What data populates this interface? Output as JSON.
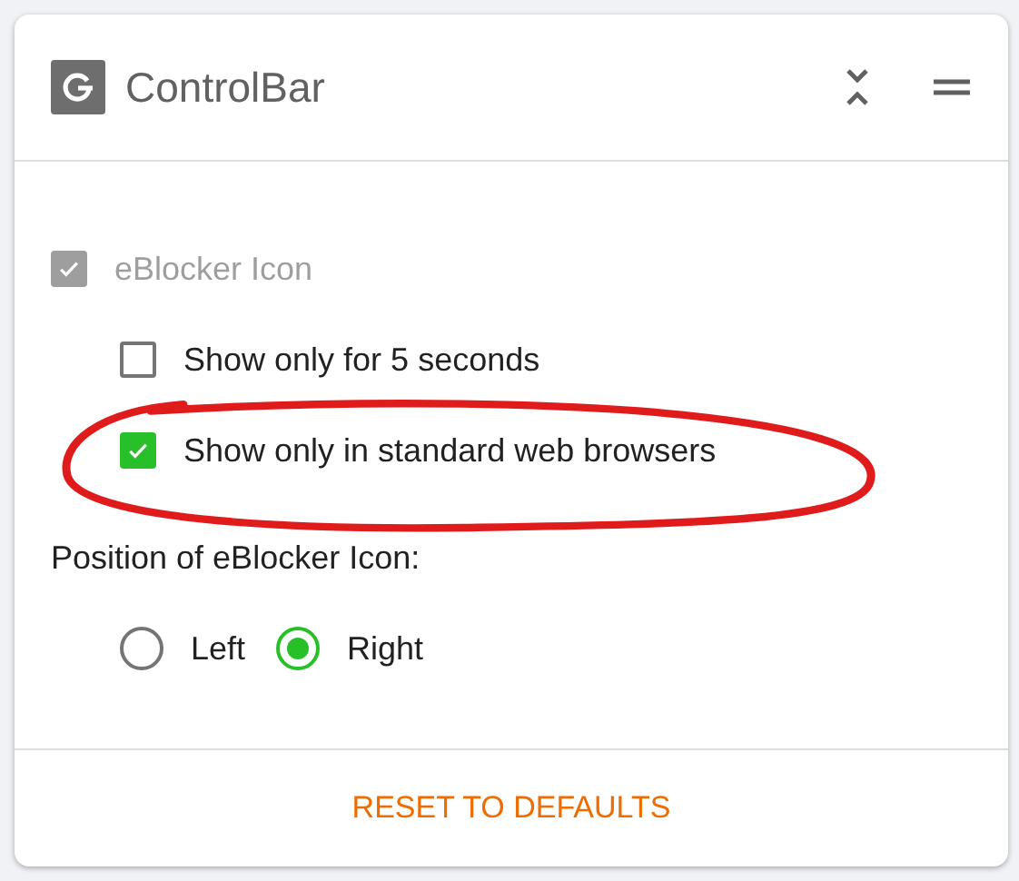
{
  "card": {
    "title": "ControlBar"
  },
  "main_option": {
    "label": "eBlocker Icon",
    "checked": true,
    "disabled": true
  },
  "sub_options": [
    {
      "label": "Show only for 5 seconds",
      "checked": false,
      "circled": false
    },
    {
      "label": "Show only in standard web browsers",
      "checked": true,
      "circled": true
    }
  ],
  "position": {
    "label": "Position of eBlocker Icon:",
    "options": [
      {
        "label": "Left",
        "selected": false
      },
      {
        "label": "Right",
        "selected": true
      }
    ]
  },
  "reset_button": "RESET TO DEFAULTS"
}
